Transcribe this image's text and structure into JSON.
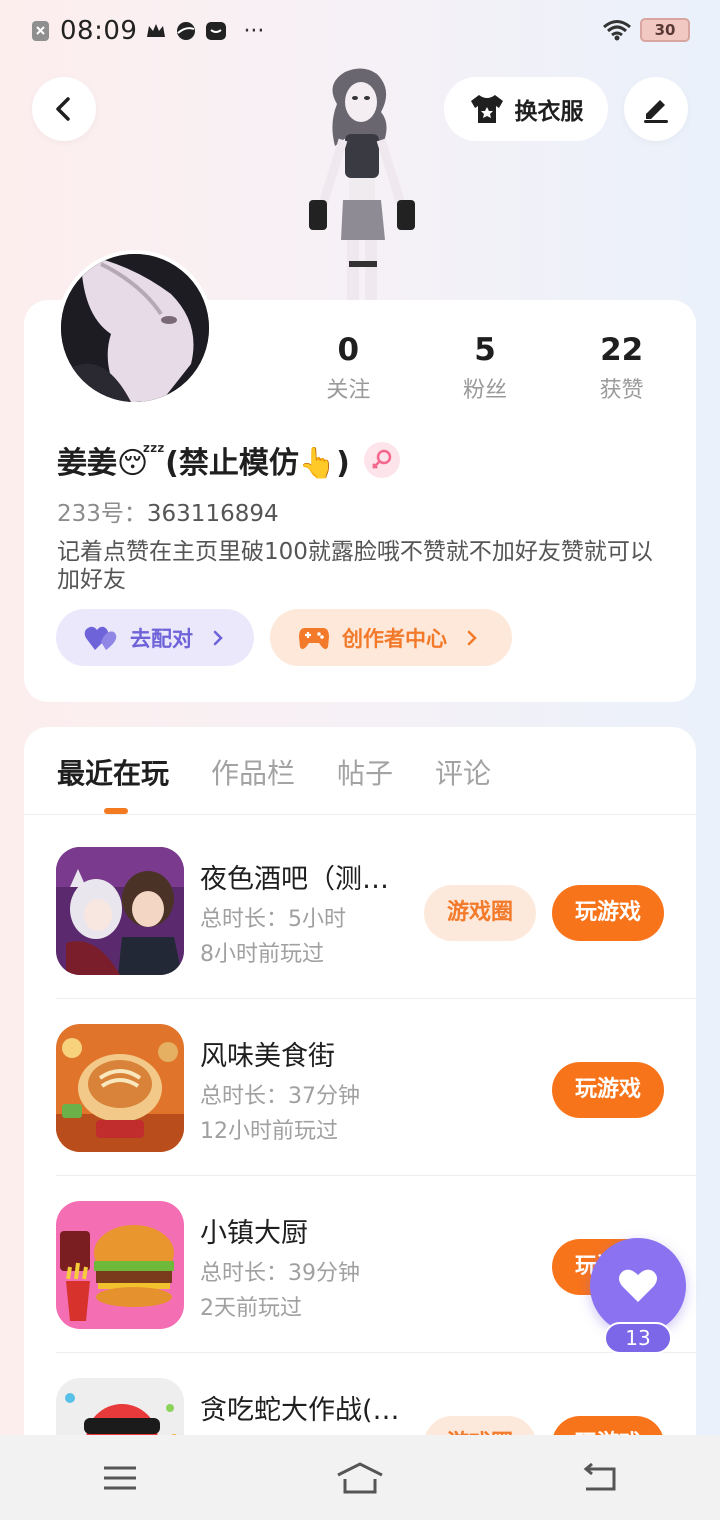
{
  "status_bar": {
    "time": "08:09",
    "more": "···",
    "battery": "30"
  },
  "header": {
    "back_icon": "chevron-left-icon",
    "outfit_label": "换衣服",
    "edit_icon": "pen-icon"
  },
  "profile": {
    "stats": [
      {
        "value": "0",
        "label": "关注"
      },
      {
        "value": "5",
        "label": "粉丝"
      },
      {
        "value": "22",
        "label": "获赞"
      }
    ],
    "nickname": "姜姜😴(禁止模仿👆)",
    "uid_label": "233号：",
    "uid_value": "363116894",
    "bio": "记着点赞在主页里破100就露脸哦不赞就不加好友赞就可以加好友",
    "match_button": "去配对",
    "creator_button": "创作者中心"
  },
  "tabs": [
    "最近在玩",
    "作品栏",
    "帖子",
    "评论"
  ],
  "games": [
    {
      "name": "夜色酒吧（测…",
      "duration": "总时长：5小时",
      "last_played": "8小时前玩过",
      "circle_label": "游戏圈",
      "play_label": "玩游戏"
    },
    {
      "name": "风味美食街",
      "duration": "总时长：37分钟",
      "last_played": "12小时前玩过",
      "circle_label": "",
      "play_label": "玩游戏"
    },
    {
      "name": "小镇大厨",
      "duration": "总时长：39分钟",
      "last_played": "2天前玩过",
      "circle_label": "",
      "play_label": "玩游戏"
    },
    {
      "name": "贪吃蛇大作战(…",
      "duration": "",
      "last_played": "",
      "circle_label": "游戏圈",
      "play_label": "玩游戏"
    }
  ],
  "float_like": {
    "count": "13"
  },
  "colors": {
    "accent": "#f8741b",
    "purple": "#8a72f0"
  }
}
